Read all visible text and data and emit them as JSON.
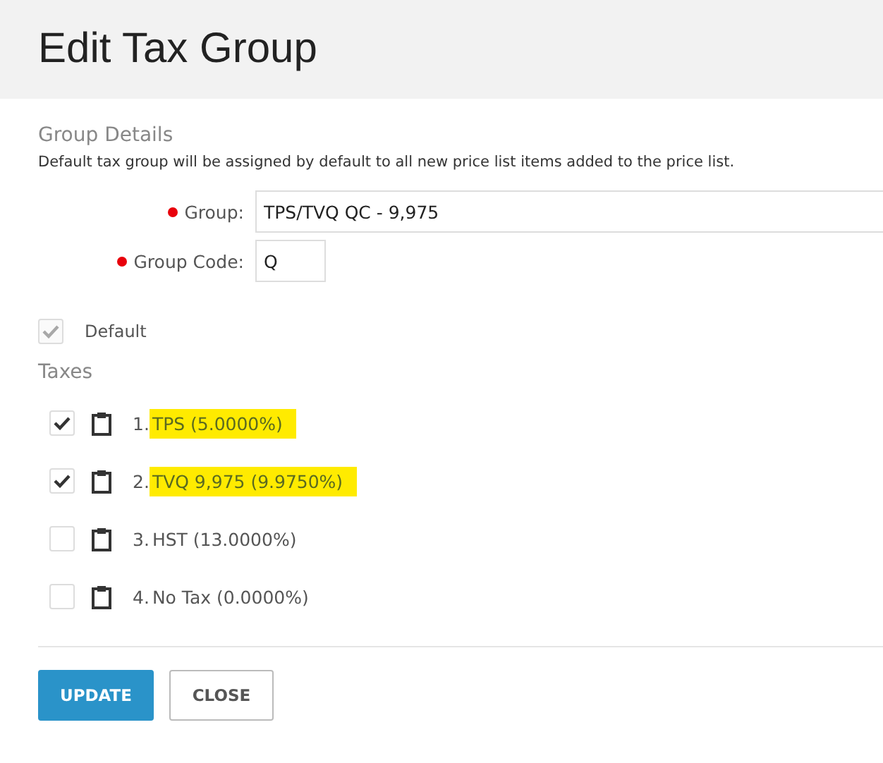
{
  "header": {
    "title": "Edit Tax Group"
  },
  "group_details": {
    "title": "Group Details",
    "description": "Default tax group will be assigned by default to all new price list items added to the price list.",
    "fields": [
      {
        "label": "Group:",
        "required": true,
        "value": "TPS/TVQ QC - 9,975",
        "kind": "wide"
      },
      {
        "label": "Group Code:",
        "required": true,
        "value": "Q",
        "kind": "short"
      }
    ],
    "default": {
      "label": "Default",
      "checked": true,
      "disabled": true
    }
  },
  "taxes": {
    "title": "Taxes",
    "items": [
      {
        "number": "1.",
        "name": "TPS (5.0000%)",
        "checked": true,
        "highlighted": true
      },
      {
        "number": "2.",
        "name": "TVQ 9,975 (9.9750%)",
        "checked": true,
        "highlighted": true
      },
      {
        "number": "3.",
        "name": "HST (13.0000%)",
        "checked": false,
        "highlighted": false
      },
      {
        "number": "4.",
        "name": "No Tax (0.0000%)",
        "checked": false,
        "highlighted": false
      }
    ]
  },
  "buttons": [
    {
      "label": "UPDATE",
      "kind": "primary"
    },
    {
      "label": "CLOSE",
      "kind": "secondary"
    }
  ]
}
